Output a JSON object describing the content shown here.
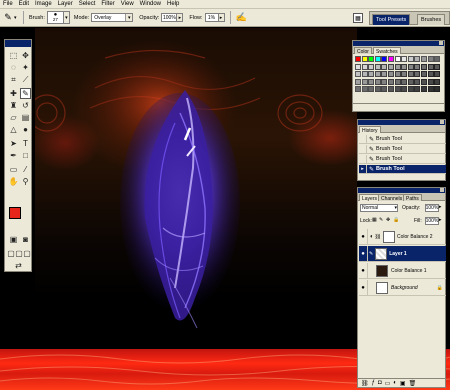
{
  "menubar": {
    "items": [
      "File",
      "Edit",
      "Image",
      "Layer",
      "Select",
      "Filter",
      "View",
      "Window",
      "Help"
    ]
  },
  "options": {
    "brush_label": "Brush:",
    "brush_size": "27",
    "mode_label": "Mode:",
    "mode_value": "Overlay",
    "opacity_label": "Opacity:",
    "opacity_value": "100%",
    "flow_label": "Flow:",
    "flow_value": "1%"
  },
  "well": {
    "tabs": [
      "Tool Presets",
      "Brushes"
    ]
  },
  "swatches_panel": {
    "tabs": [
      "Color",
      "Swatches"
    ]
  },
  "history_panel": {
    "tabs": [
      "History"
    ],
    "items": [
      "Brush Tool",
      "Brush Tool",
      "Brush Tool",
      "Brush Tool"
    ],
    "selected_index": 3
  },
  "layers_panel": {
    "tabs": [
      "Layers",
      "Channels",
      "Paths"
    ],
    "blend_mode": "Normal",
    "opacity_label": "Opacity:",
    "opacity_value": "100%",
    "lock_label": "Lock:",
    "fill_label": "Fill:",
    "fill_value": "100%",
    "layers": [
      "Color Balance 2",
      "Layer 1",
      "Color Balance 1",
      "Background"
    ],
    "selected_index": 1
  },
  "colors": {
    "foreground": "#e8251b",
    "background": "#ffffff",
    "accent": "#0a246a",
    "ui_face": "#ece9d8"
  }
}
